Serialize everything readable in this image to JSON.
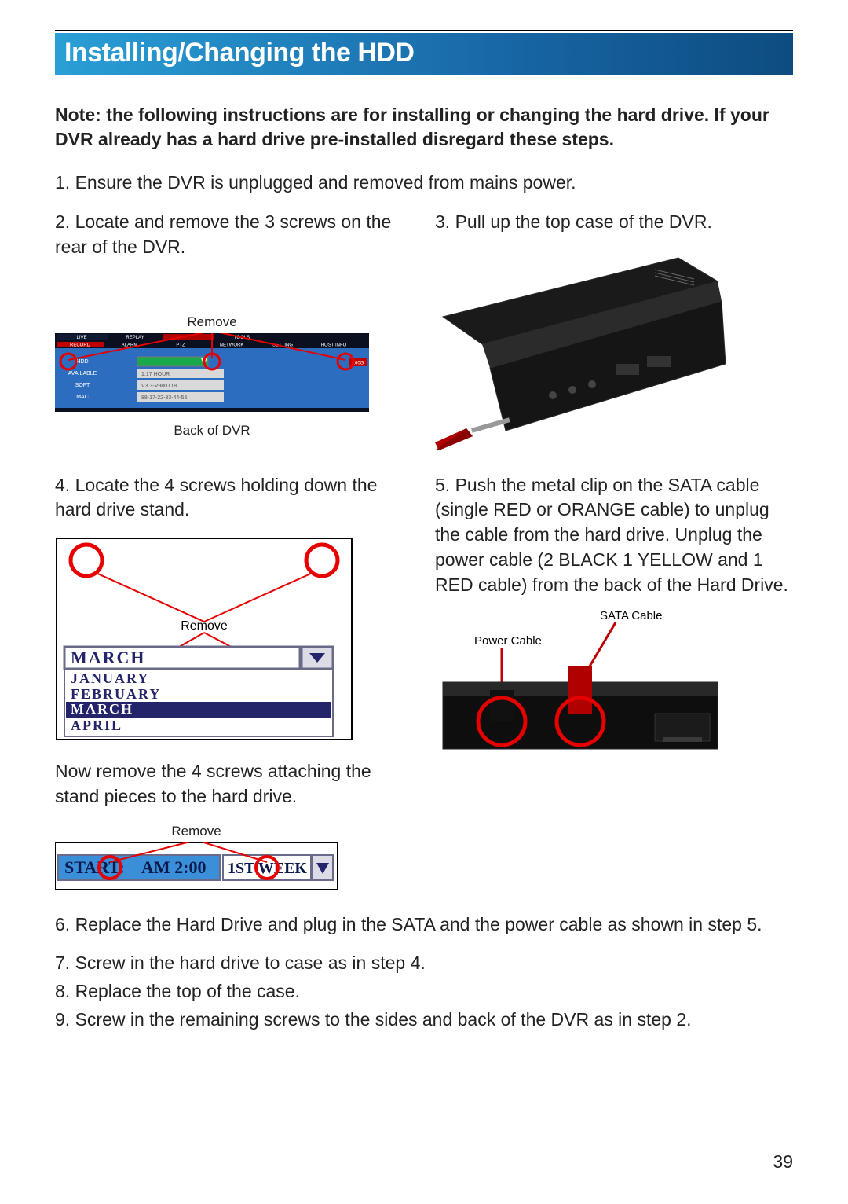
{
  "page_number": "39",
  "title": "Installing/Changing the HDD",
  "note": "Note: the following instructions are for installing or changing the hard drive.  If your DVR already has a hard drive pre-installed disregard these steps.",
  "steps": {
    "s1": "1.  Ensure the DVR is unplugged and removed from mains power.",
    "s2": "2. Locate and remove the 3 screws on the rear of the DVR.",
    "s3": "3. Pull up the top case of the DVR.",
    "s4": "4.  Locate the 4 screws holding down the hard drive stand.",
    "s4b": "Now remove the 4 screws attaching the stand pieces to the hard drive.",
    "s5": "5.  Push the metal clip on the SATA cable (single RED or ORANGE cable) to unplug the cable from the hard drive. Unplug the power cable (2 BLACK 1 YELLOW and 1 RED cable) from the back of the Hard Drive.",
    "s6": "6.  Replace the Hard Drive and plug in the SATA and the power cable as shown in step 5.",
    "s7": "7.  Screw in the hard drive to case as in step 4.",
    "s8": "8.  Replace the top of the case.",
    "s9": "9.  Screw in the remaining screws to the sides and back of the DVR as in step 2."
  },
  "captions": {
    "remove": "Remove",
    "back_of_dvr": "Back of DVR",
    "sata_cable": "SATA Cable",
    "power_cable": "Power Cable"
  },
  "fig1": {
    "tabs_top": [
      "LIVE",
      "REPLAY",
      "",
      "TOOLS"
    ],
    "tabs_mid": [
      "RECORD",
      "ALARM",
      "PTZ",
      "NETWORK",
      "SETTING",
      "HOST INFO"
    ],
    "rows": [
      {
        "label": "HDD",
        "value": ""
      },
      {
        "label": "AVAILABLE",
        "value": "1:17 HOUR"
      },
      {
        "label": "SOFT",
        "value": "V3.3-V980T18"
      },
      {
        "label": "MAC",
        "value": "88-17-22-33-44-55"
      }
    ],
    "right_label": "160G"
  },
  "fig3": {
    "selected": "MARCH",
    "months": [
      "JANUARY",
      "FEBRUARY",
      "MARCH",
      "APRIL"
    ]
  },
  "fig4": {
    "label": "START:",
    "time": "AM 2:00",
    "week": "1ST WEEK"
  }
}
